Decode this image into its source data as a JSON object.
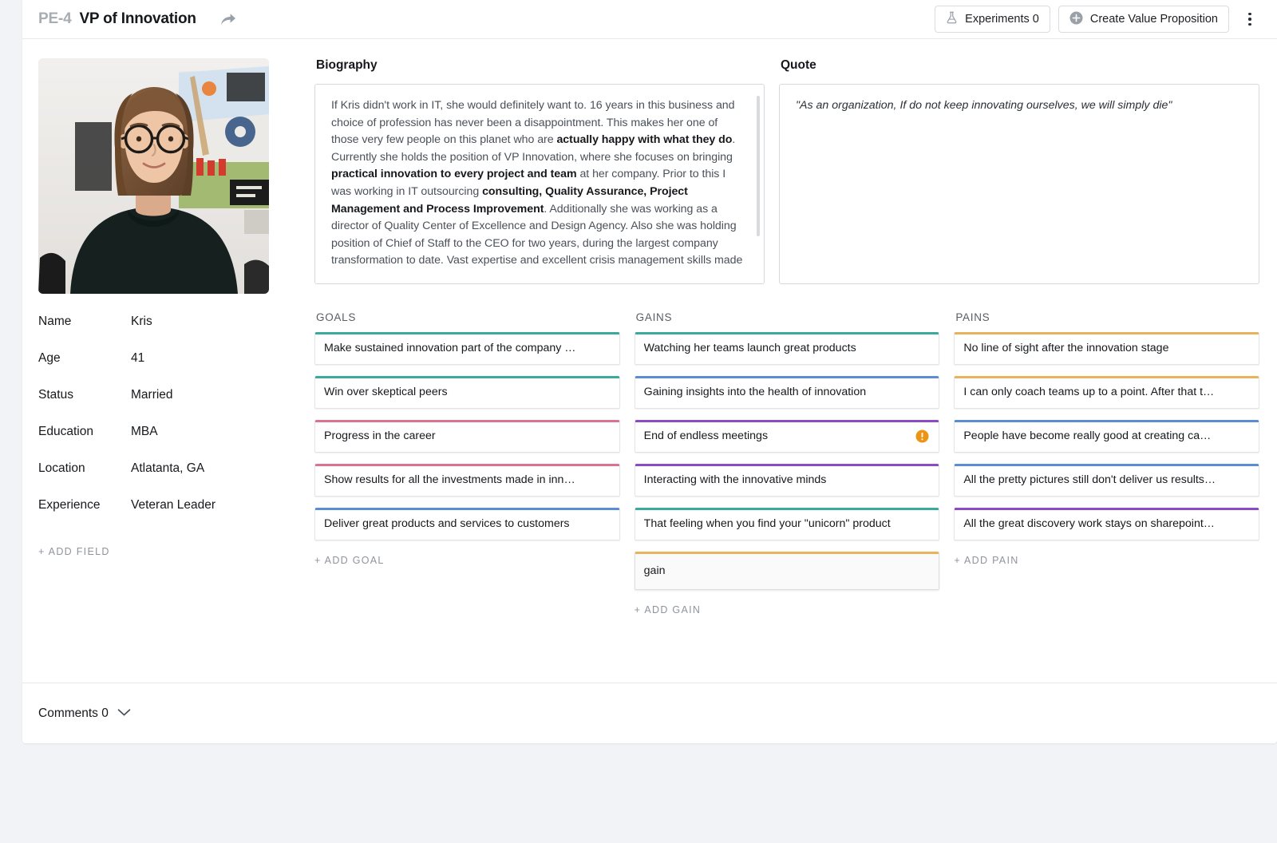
{
  "header": {
    "issue_key": "PE-4",
    "title": "VP of Innovation",
    "share_icon": "share-arrow-icon",
    "experiments_label": "Experiments 0",
    "experiments_icon": "flask-icon",
    "create_vp_label": "Create Value Proposition",
    "create_vp_icon": "plus-circle-icon",
    "more_icon": "kebab-menu-icon"
  },
  "profile": {
    "photo_alt": "portrait-photo",
    "fields": [
      {
        "label": "Name",
        "value": "Kris"
      },
      {
        "label": "Age",
        "value": "41"
      },
      {
        "label": "Status",
        "value": "Married"
      },
      {
        "label": "Education",
        "value": "MBA"
      },
      {
        "label": "Location",
        "value": "Atlatanta, GA"
      },
      {
        "label": "Experience",
        "value": "Veteran Leader"
      }
    ],
    "add_field_label": "+ ADD FIELD"
  },
  "biography": {
    "title": "Biography",
    "paragraph_plain_1": "If Kris didn't work in IT, she would definitely want to. 16 years in this business and choice of profession has never been a disappointment. This makes her one of those very few people on this planet who are ",
    "bold_1": "actually happy with what they do",
    "paragraph_plain_2": ". Currently she holds the position of VP Innovation, where she focuses on bringing ",
    "bold_2": "practical innovation to every project and team",
    "paragraph_plain_3": " at her company. Prior to this I was working in IT outsourcing ",
    "bold_3": "consulting, Quality Assurance, Project Management and Process Improvement",
    "paragraph_plain_4": ". Additionally she was working as a director of Quality Center of Excellence and Design Agency. Also she was holding position of Chief of Staff to the CEO for two years, during the largest company transformation to date. Vast expertise and excellent crisis management skills made her the first target for \"fire fighting\""
  },
  "quote": {
    "title": "Quote",
    "text": "\"As an organization, If do not keep innovating ourselves, we will simply die\""
  },
  "colors": {
    "teal": "#3ba99c",
    "pink": "#d9738f",
    "blue": "#5b8dd6",
    "purple": "#8b4bc4",
    "orange": "#e8b35c",
    "warning": "#ec9413"
  },
  "columns": [
    {
      "heading": "GOALS",
      "add_label": "+ ADD GOAL",
      "cards": [
        {
          "text": "Make sustained innovation part of the company …",
          "accent": "#3ba99c",
          "warning": false,
          "editing": false
        },
        {
          "text": "Win over skeptical peers",
          "accent": "#3ba99c",
          "warning": false,
          "editing": false
        },
        {
          "text": "Progress in the career",
          "accent": "#d9738f",
          "warning": false,
          "editing": false
        },
        {
          "text": "Show results for all the investments made in inn…",
          "accent": "#d9738f",
          "warning": false,
          "editing": false
        },
        {
          "text": "Deliver great products and services to customers",
          "accent": "#5b8dd6",
          "warning": false,
          "editing": false
        }
      ]
    },
    {
      "heading": "GAINS",
      "add_label": "+ ADD GAIN",
      "cards": [
        {
          "text": "Watching her teams launch great products",
          "accent": "#3ba99c",
          "warning": false,
          "editing": false
        },
        {
          "text": "Gaining insights into the health of innovation",
          "accent": "#5b8dd6",
          "warning": false,
          "editing": false
        },
        {
          "text": "End of endless meetings",
          "accent": "#8b4bc4",
          "warning": true,
          "editing": false
        },
        {
          "text": "Interacting with the innovative minds",
          "accent": "#8b4bc4",
          "warning": false,
          "editing": false
        },
        {
          "text": "That feeling when you find your \"unicorn\" product",
          "accent": "#3ba99c",
          "warning": false,
          "editing": false
        },
        {
          "text": "gain",
          "accent": "#e8b35c",
          "warning": false,
          "editing": true
        }
      ]
    },
    {
      "heading": "PAINS",
      "add_label": "+ ADD PAIN",
      "cards": [
        {
          "text": "No line of sight after the innovation stage",
          "accent": "#e8b35c",
          "warning": false,
          "editing": false
        },
        {
          "text": "I can only coach teams up to a point. After that t…",
          "accent": "#e8b35c",
          "warning": false,
          "editing": false
        },
        {
          "text": "People have become really good at creating ca…",
          "accent": "#5b8dd6",
          "warning": false,
          "editing": false
        },
        {
          "text": "All the pretty pictures still don't deliver us results…",
          "accent": "#5b8dd6",
          "warning": false,
          "editing": false
        },
        {
          "text": "All the great discovery work stays on sharepoint…",
          "accent": "#8b4bc4",
          "warning": false,
          "editing": false
        }
      ]
    }
  ],
  "footer": {
    "comments_label": "Comments 0",
    "chevron_icon": "chevron-down-icon"
  }
}
